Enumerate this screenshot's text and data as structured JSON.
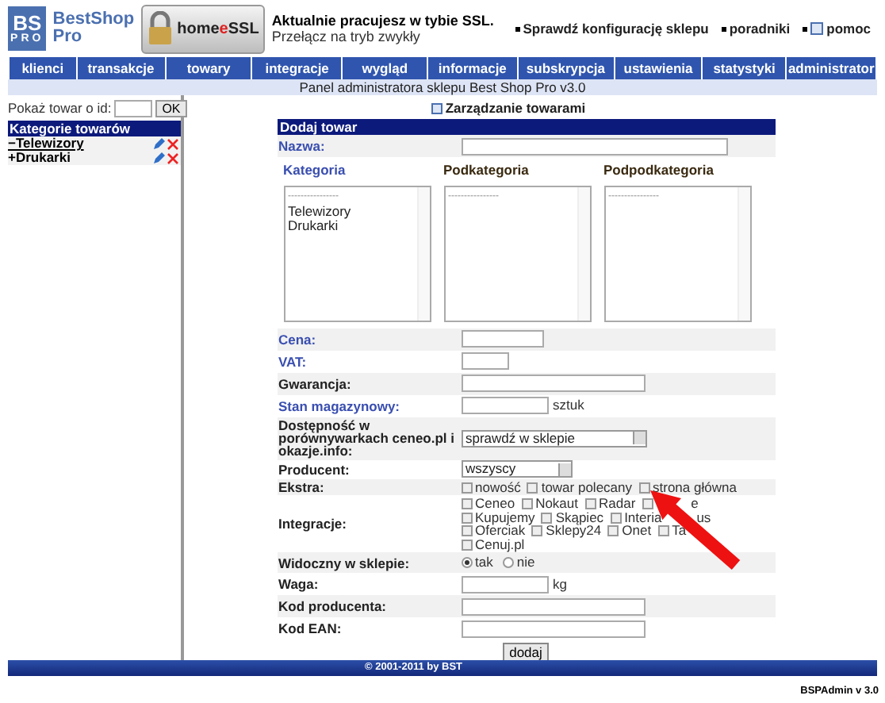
{
  "logo": {
    "mark_top": "BS",
    "mark_bottom": "PRO",
    "name_line1": "BestShop",
    "name_line2": "Pro"
  },
  "ssl_badge": {
    "label_dark": "home",
    "label_accent": "e",
    "label_end": "SSL"
  },
  "ssl_notice": {
    "title": "Aktualnie pracujesz w tybie SSL.",
    "link": "Przełącz na tryb zwykły"
  },
  "top_links": [
    {
      "label": "Sprawdź konfigurację sklepu",
      "help": false
    },
    {
      "label": "poradniki",
      "help": false
    },
    {
      "label": "pomoc",
      "help": true
    }
  ],
  "nav": [
    "klienci",
    "transakcje",
    "towary",
    "integracje",
    "wygląd",
    "informacje",
    "subskrypcja",
    "ustawienia",
    "statystyki",
    "administrator"
  ],
  "subtitle": "Panel administratora sklepu Best Shop Pro v3.0",
  "sidebar": {
    "id_label": "Pokaż towar o id:",
    "ok": "OK",
    "tree_title": "Kategorie towarów",
    "items": [
      {
        "toggle": "−",
        "label": "Telewizory",
        "selected": true
      },
      {
        "toggle": "+",
        "label": "Drukarki",
        "selected": false
      }
    ]
  },
  "help_link": "Zarządzanie towarami",
  "form": {
    "title": "Dodaj towar",
    "rows": [
      {
        "kind": "text",
        "label": "Nazwa:",
        "highlighted": true
      },
      {
        "kind": "lists",
        "columns": [
          {
            "label": "Kategoria",
            "highlighted": true,
            "options": [
              "----------------",
              "Telewizory",
              "Drukarki"
            ]
          },
          {
            "label": "Podkategoria",
            "highlighted": false,
            "options": [
              "----------------"
            ]
          },
          {
            "label": "Podpodkategoria",
            "highlighted": false,
            "options": [
              "----------------"
            ]
          }
        ]
      },
      {
        "kind": "text",
        "label": "Cena:",
        "highlighted": true
      },
      {
        "kind": "text",
        "label": "VAT:",
        "highlighted": true
      },
      {
        "kind": "text",
        "label": "Gwarancja:",
        "highlighted": false
      },
      {
        "kind": "text",
        "label": "Stan magazynowy:",
        "highlighted": true,
        "unit": "sztuk"
      },
      {
        "kind": "select",
        "label": "Dostępność w porównywarkach ceneo.pl i okazje.info:",
        "highlighted": false,
        "value": "sprawdź w sklepie"
      },
      {
        "kind": "select",
        "label": "Producent:",
        "highlighted": false,
        "value": "wszyscy"
      },
      {
        "kind": "checks",
        "label": "Ekstra:",
        "highlighted": false,
        "lines": [
          [
            {
              "label": "nowość",
              "checked": false
            },
            {
              "label": "towar polecany",
              "checked": false
            },
            {
              "label": "strona główna",
              "checked": false
            }
          ]
        ]
      },
      {
        "kind": "checks",
        "label": "Integracje:",
        "highlighted": false,
        "lines": [
          [
            {
              "label": "Ceneo",
              "checked": false
            },
            {
              "label": "Nokaut",
              "checked": false
            },
            {
              "label": "Radar",
              "checked": false
            },
            {
              "label": "e",
              "checked": false,
              "covered": true
            }
          ],
          [
            {
              "label": "Kupujemy",
              "checked": false
            },
            {
              "label": "Skąpiec",
              "checked": false
            },
            {
              "label": "Interia",
              "checked": false,
              "tail": "us"
            }
          ],
          [
            {
              "label": "Oferciak",
              "checked": false
            },
            {
              "label": "Sklepy24",
              "checked": false
            },
            {
              "label": "Onet",
              "checked": false
            },
            {
              "label": "Ta",
              "checked": false
            }
          ],
          [
            {
              "label": "Cenuj.pl",
              "checked": false
            }
          ]
        ]
      },
      {
        "kind": "radio",
        "label": "Widoczny w sklepie:",
        "highlighted": false,
        "options": [
          {
            "label": "tak",
            "selected": true
          },
          {
            "label": "nie",
            "selected": false
          }
        ]
      },
      {
        "kind": "text",
        "label": "Waga:",
        "highlighted": false,
        "unit": "kg"
      },
      {
        "kind": "text",
        "label": "Kod producenta:",
        "highlighted": false
      },
      {
        "kind": "text",
        "label": "Kod EAN:",
        "highlighted": false
      }
    ],
    "submit": "dodaj"
  },
  "footer": "© 2001-2011 by BST",
  "version": "BSPAdmin v 3.0"
}
